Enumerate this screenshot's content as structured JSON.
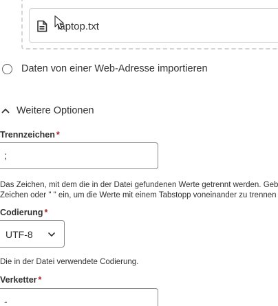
{
  "upload": {
    "file_name": "laptop.txt",
    "file_icon": "document-icon"
  },
  "source_option": {
    "label": "Daten von einer Web-Adresse importieren"
  },
  "options_toggle": {
    "label": "Weitere Optionen",
    "icon": "chevron-up-icon"
  },
  "fields": {
    "delimiter": {
      "label": "Trennzeichen",
      "required_mark": "*",
      "value": ";",
      "help_line1": "Das Zeichen, mit dem die in der Datei gefundenen Werte getrennt werden. Geb",
      "help_line2": "Zeichen oder \" \" ein, um die Werte mit einem Tabstopp voneinander zu trennen"
    },
    "encoding": {
      "label": "Codierung",
      "required_mark": "*",
      "value": "UTF-8",
      "help": "Die in der Datei verwendete Codierung."
    },
    "concatenator": {
      "label": "Verketter",
      "required_mark": "*",
      "value": "-"
    }
  }
}
